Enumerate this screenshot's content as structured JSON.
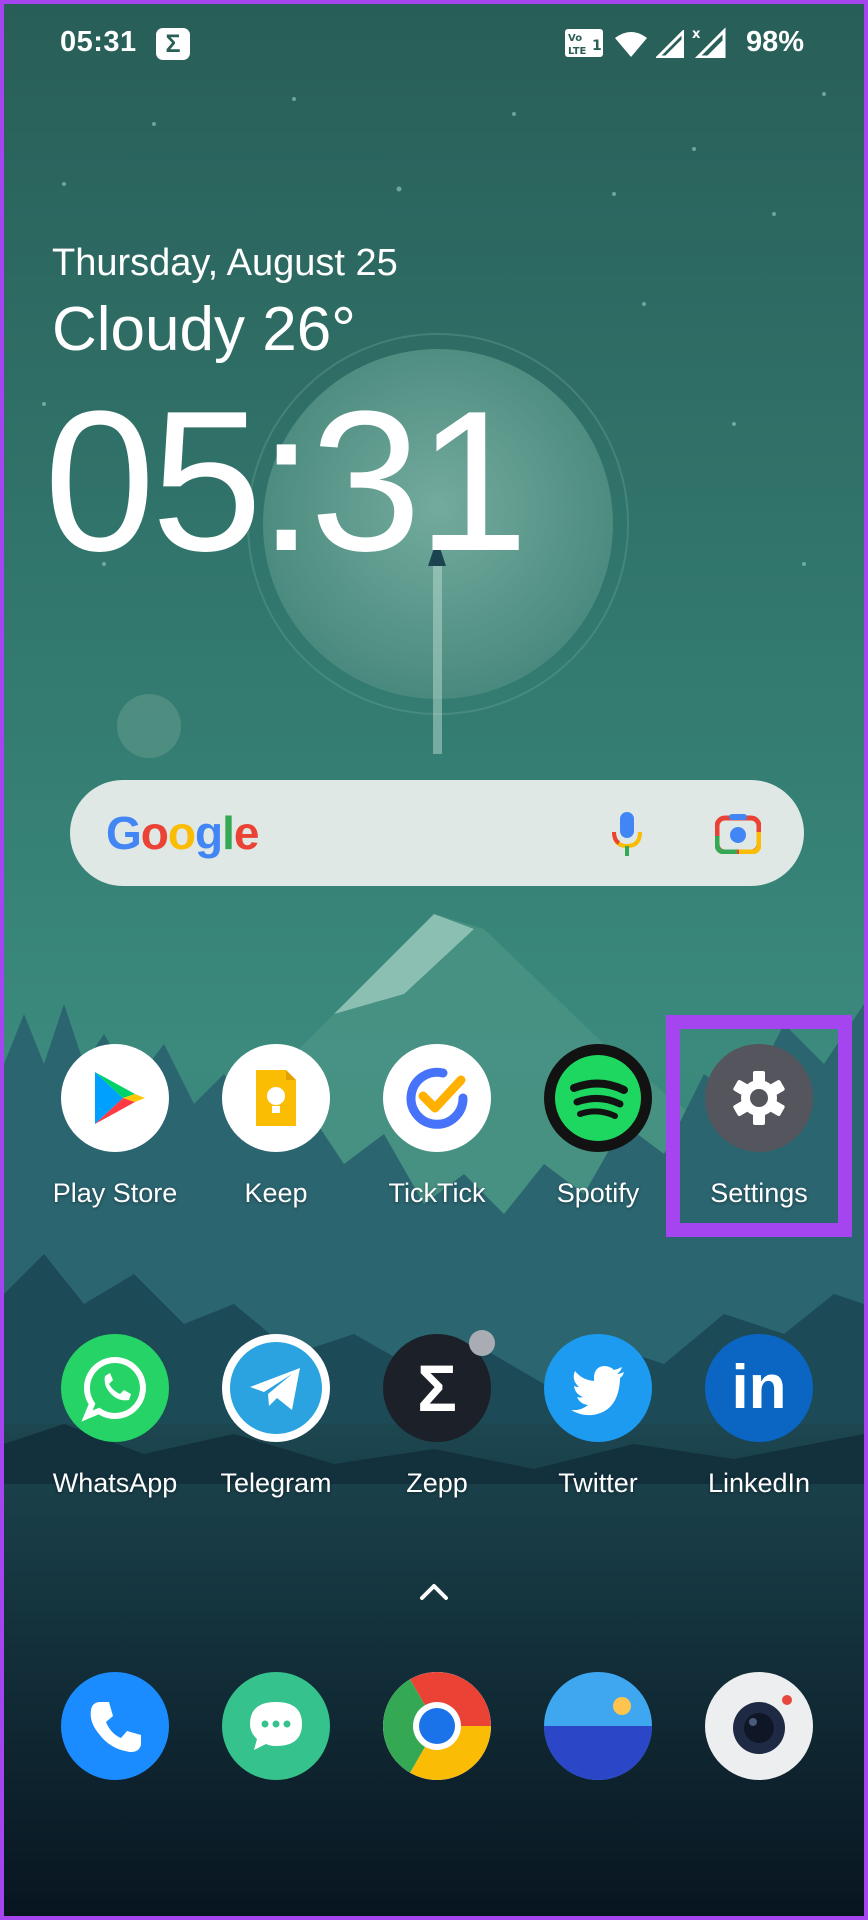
{
  "status_bar": {
    "time": "05:31",
    "app_badge_glyph": "Σ",
    "network_badge": "VoLTE 1",
    "battery": "98%",
    "icons": [
      "volte-icon",
      "wifi-icon",
      "signal-icon",
      "signal-no-data-icon"
    ]
  },
  "widget": {
    "date": "Thursday, August 25",
    "weather": "Cloudy 26°",
    "clock": "05:31"
  },
  "search": {
    "logo": "Google",
    "icons": [
      "mic-icon",
      "lens-icon"
    ]
  },
  "apps_row1": [
    {
      "label": "Play Store",
      "icon": "play-store-icon"
    },
    {
      "label": "Keep",
      "icon": "keep-icon"
    },
    {
      "label": "TickTick",
      "icon": "ticktick-icon"
    },
    {
      "label": "Spotify",
      "icon": "spotify-icon"
    },
    {
      "label": "Settings",
      "icon": "gear-icon",
      "highlighted": true
    }
  ],
  "apps_row2": [
    {
      "label": "WhatsApp",
      "icon": "whatsapp-icon"
    },
    {
      "label": "Telegram",
      "icon": "telegram-icon"
    },
    {
      "label": "Zepp",
      "icon": "zepp-icon",
      "zepp_glyph": "Σ"
    },
    {
      "label": "Twitter",
      "icon": "twitter-icon"
    },
    {
      "label": "LinkedIn",
      "icon": "linkedin-icon",
      "logo_text": "in"
    }
  ],
  "dock": [
    {
      "icon": "phone-icon"
    },
    {
      "icon": "messages-icon"
    },
    {
      "icon": "chrome-icon"
    },
    {
      "icon": "gallery-icon"
    },
    {
      "icon": "camera-icon"
    }
  ],
  "colors": {
    "highlight": "#a445f0",
    "wallpaper_top": "#2c6a62",
    "wallpaper_bottom": "#0b1a26"
  }
}
